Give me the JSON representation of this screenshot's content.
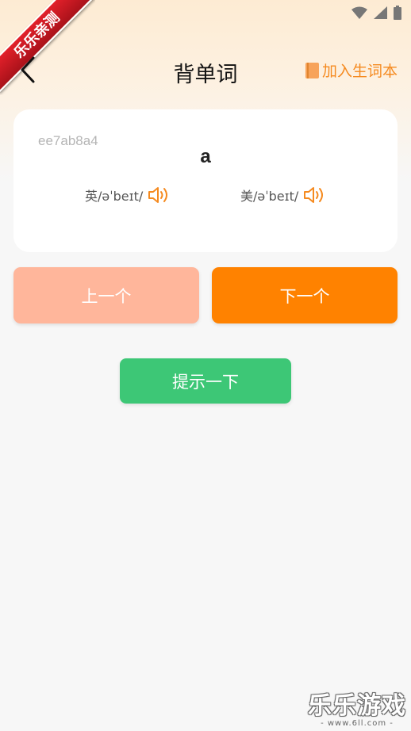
{
  "ribbon": {
    "text": "乐乐亲测"
  },
  "header": {
    "title": "背单词",
    "add_vocab_label": "加入生词本"
  },
  "card": {
    "word_id": "ee7ab8a4",
    "word": "a",
    "uk_phonetic": "英/əˈbeɪt/",
    "us_phonetic": "美/əˈbeɪt/"
  },
  "buttons": {
    "prev": "上一个",
    "next": "下一个",
    "hint": "提示一下"
  },
  "watermark": {
    "main": "乐乐游戏",
    "sub": "- www.6ll.com -"
  },
  "colors": {
    "accent_orange": "#ff8200",
    "prev_button": "#ffb69b",
    "hint_green": "#3dc776",
    "vocab_orange": "#f58a1f"
  },
  "icons": [
    "back-arrow-icon",
    "book-icon",
    "speaker-icon",
    "wifi-icon",
    "signal-icon",
    "battery-icon"
  ]
}
